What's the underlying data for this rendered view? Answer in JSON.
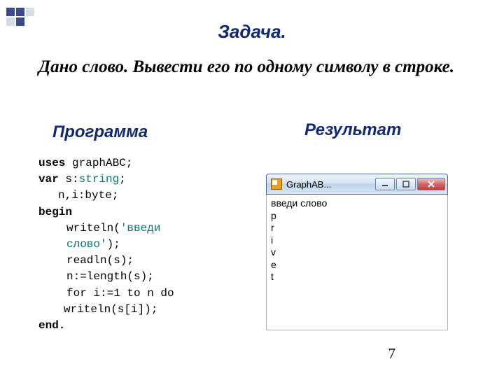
{
  "title": "Задача.",
  "problem": "Дано слово.  Вывести его по  одному символу в строке.",
  "labels": {
    "program": "Программа",
    "result": "Результат"
  },
  "code": {
    "l1a": "uses",
    "l1b": " graphABC;",
    "l2a": "var",
    "l2b": " s:",
    "l2c": "string",
    "l2d": ";",
    "l3": "n,i:byte;",
    "l4": "begin",
    "l5a": "writeln(",
    "l5b": "'введи слово'",
    "l5c": ");",
    "l6": "readln(s);",
    "l7": "n:=length(s);",
    "l8": "for i:=1 to n do",
    "l9": "writeln(s[i]);",
    "l10": "end."
  },
  "window": {
    "title": "GraphAB...",
    "output": "введи слово\np\nr\ni\nv\ne\nt"
  },
  "page_number": "7"
}
